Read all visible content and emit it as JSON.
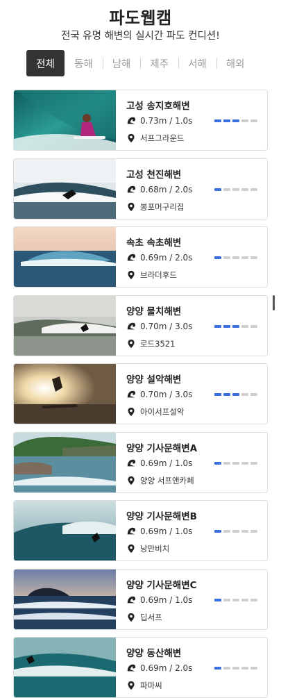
{
  "header": {
    "title": "파도웹캠",
    "subtitle": "전국 유명 해변의 실시간 파도 컨디션!"
  },
  "tabs": [
    {
      "label": "전체",
      "active": true
    },
    {
      "label": "동해",
      "active": false
    },
    {
      "label": "남해",
      "active": false
    },
    {
      "label": "제주",
      "active": false
    },
    {
      "label": "서해",
      "active": false
    },
    {
      "label": "해외",
      "active": false
    }
  ],
  "colors": {
    "accent_blue": "#3b6fe0",
    "tab_active_bg": "#333333",
    "bar_off": "#cfcfcf"
  },
  "bar_total": 5,
  "beaches": [
    {
      "name": "고성 송지호해변",
      "wave": "0.73m / 1.0s",
      "shop": "서프그라운드",
      "level": 3,
      "thumb": "surf-barrel"
    },
    {
      "name": "고성 천진해변",
      "wave": "0.68m / 2.0s",
      "shop": "봉포머구리집",
      "level": 1,
      "thumb": "surfer-wave"
    },
    {
      "name": "속초 속초해변",
      "wave": "0.69m / 2.0s",
      "shop": "브라더후드",
      "level": 1,
      "thumb": "sunset-wave"
    },
    {
      "name": "양양 물치해변",
      "wave": "0.70m / 3.0s",
      "shop": "로드3521",
      "level": 3,
      "thumb": "grey-wave"
    },
    {
      "name": "양양 설악해변",
      "wave": "0.70m / 3.0s",
      "shop": "아이서프설악",
      "level": 3,
      "thumb": "sun-jump"
    },
    {
      "name": "양양 기사문해변A",
      "wave": "0.69m / 1.0s",
      "shop": "양양 서프앤카페",
      "level": 1,
      "thumb": "coast-hills"
    },
    {
      "name": "양양 기사문해변B",
      "wave": "0.69m / 1.0s",
      "shop": "낭만비치",
      "level": 1,
      "thumb": "teal-wave"
    },
    {
      "name": "양양 기사문해변C",
      "wave": "0.69m / 1.0s",
      "shop": "딥서프",
      "level": 1,
      "thumb": "island-dusk"
    },
    {
      "name": "양양 동산해변",
      "wave": "0.69m / 2.0s",
      "shop": "파마씨",
      "level": 1,
      "thumb": "teal-surfer"
    }
  ]
}
